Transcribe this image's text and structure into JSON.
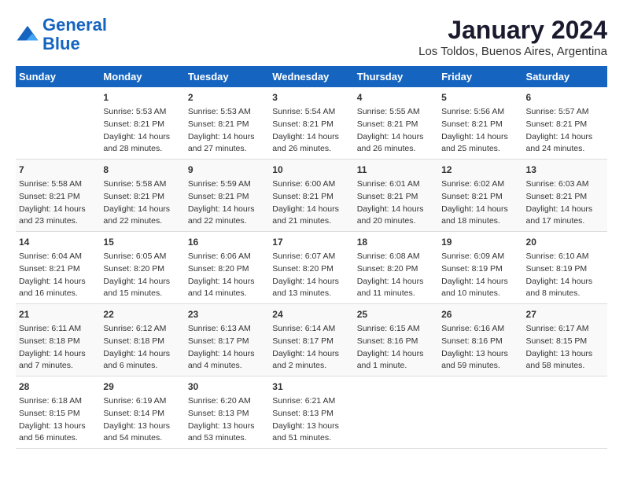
{
  "header": {
    "logo_line1": "General",
    "logo_line2": "Blue",
    "title": "January 2024",
    "subtitle": "Los Toldos, Buenos Aires, Argentina"
  },
  "weekdays": [
    "Sunday",
    "Monday",
    "Tuesday",
    "Wednesday",
    "Thursday",
    "Friday",
    "Saturday"
  ],
  "weeks": [
    [
      {
        "day": "",
        "info": ""
      },
      {
        "day": "1",
        "info": "Sunrise: 5:53 AM\nSunset: 8:21 PM\nDaylight: 14 hours\nand 28 minutes."
      },
      {
        "day": "2",
        "info": "Sunrise: 5:53 AM\nSunset: 8:21 PM\nDaylight: 14 hours\nand 27 minutes."
      },
      {
        "day": "3",
        "info": "Sunrise: 5:54 AM\nSunset: 8:21 PM\nDaylight: 14 hours\nand 26 minutes."
      },
      {
        "day": "4",
        "info": "Sunrise: 5:55 AM\nSunset: 8:21 PM\nDaylight: 14 hours\nand 26 minutes."
      },
      {
        "day": "5",
        "info": "Sunrise: 5:56 AM\nSunset: 8:21 PM\nDaylight: 14 hours\nand 25 minutes."
      },
      {
        "day": "6",
        "info": "Sunrise: 5:57 AM\nSunset: 8:21 PM\nDaylight: 14 hours\nand 24 minutes."
      }
    ],
    [
      {
        "day": "7",
        "info": "Sunrise: 5:58 AM\nSunset: 8:21 PM\nDaylight: 14 hours\nand 23 minutes."
      },
      {
        "day": "8",
        "info": "Sunrise: 5:58 AM\nSunset: 8:21 PM\nDaylight: 14 hours\nand 22 minutes."
      },
      {
        "day": "9",
        "info": "Sunrise: 5:59 AM\nSunset: 8:21 PM\nDaylight: 14 hours\nand 22 minutes."
      },
      {
        "day": "10",
        "info": "Sunrise: 6:00 AM\nSunset: 8:21 PM\nDaylight: 14 hours\nand 21 minutes."
      },
      {
        "day": "11",
        "info": "Sunrise: 6:01 AM\nSunset: 8:21 PM\nDaylight: 14 hours\nand 20 minutes."
      },
      {
        "day": "12",
        "info": "Sunrise: 6:02 AM\nSunset: 8:21 PM\nDaylight: 14 hours\nand 18 minutes."
      },
      {
        "day": "13",
        "info": "Sunrise: 6:03 AM\nSunset: 8:21 PM\nDaylight: 14 hours\nand 17 minutes."
      }
    ],
    [
      {
        "day": "14",
        "info": "Sunrise: 6:04 AM\nSunset: 8:21 PM\nDaylight: 14 hours\nand 16 minutes."
      },
      {
        "day": "15",
        "info": "Sunrise: 6:05 AM\nSunset: 8:20 PM\nDaylight: 14 hours\nand 15 minutes."
      },
      {
        "day": "16",
        "info": "Sunrise: 6:06 AM\nSunset: 8:20 PM\nDaylight: 14 hours\nand 14 minutes."
      },
      {
        "day": "17",
        "info": "Sunrise: 6:07 AM\nSunset: 8:20 PM\nDaylight: 14 hours\nand 13 minutes."
      },
      {
        "day": "18",
        "info": "Sunrise: 6:08 AM\nSunset: 8:20 PM\nDaylight: 14 hours\nand 11 minutes."
      },
      {
        "day": "19",
        "info": "Sunrise: 6:09 AM\nSunset: 8:19 PM\nDaylight: 14 hours\nand 10 minutes."
      },
      {
        "day": "20",
        "info": "Sunrise: 6:10 AM\nSunset: 8:19 PM\nDaylight: 14 hours\nand 8 minutes."
      }
    ],
    [
      {
        "day": "21",
        "info": "Sunrise: 6:11 AM\nSunset: 8:18 PM\nDaylight: 14 hours\nand 7 minutes."
      },
      {
        "day": "22",
        "info": "Sunrise: 6:12 AM\nSunset: 8:18 PM\nDaylight: 14 hours\nand 6 minutes."
      },
      {
        "day": "23",
        "info": "Sunrise: 6:13 AM\nSunset: 8:17 PM\nDaylight: 14 hours\nand 4 minutes."
      },
      {
        "day": "24",
        "info": "Sunrise: 6:14 AM\nSunset: 8:17 PM\nDaylight: 14 hours\nand 2 minutes."
      },
      {
        "day": "25",
        "info": "Sunrise: 6:15 AM\nSunset: 8:16 PM\nDaylight: 14 hours\nand 1 minute."
      },
      {
        "day": "26",
        "info": "Sunrise: 6:16 AM\nSunset: 8:16 PM\nDaylight: 13 hours\nand 59 minutes."
      },
      {
        "day": "27",
        "info": "Sunrise: 6:17 AM\nSunset: 8:15 PM\nDaylight: 13 hours\nand 58 minutes."
      }
    ],
    [
      {
        "day": "28",
        "info": "Sunrise: 6:18 AM\nSunset: 8:15 PM\nDaylight: 13 hours\nand 56 minutes."
      },
      {
        "day": "29",
        "info": "Sunrise: 6:19 AM\nSunset: 8:14 PM\nDaylight: 13 hours\nand 54 minutes."
      },
      {
        "day": "30",
        "info": "Sunrise: 6:20 AM\nSunset: 8:13 PM\nDaylight: 13 hours\nand 53 minutes."
      },
      {
        "day": "31",
        "info": "Sunrise: 6:21 AM\nSunset: 8:13 PM\nDaylight: 13 hours\nand 51 minutes."
      },
      {
        "day": "",
        "info": ""
      },
      {
        "day": "",
        "info": ""
      },
      {
        "day": "",
        "info": ""
      }
    ]
  ]
}
